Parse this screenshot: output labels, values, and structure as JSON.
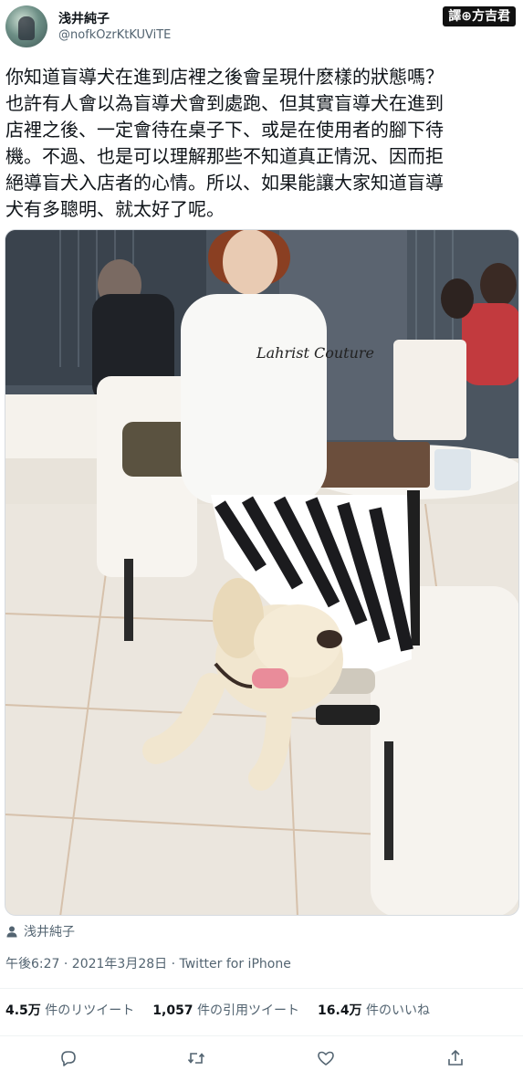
{
  "user": {
    "display_name": "浅井純子",
    "handle": "@nofkOzrKtKUViTE"
  },
  "watermark": "譯⊕方吉君",
  "tweet": {
    "text": "你知道盲導犬在進到店裡之後會呈現什麽樣的狀態嗎？\n也許有人會以為盲導犬會到處跑、但其實盲導犬在進到\n店裡之後、一定會待在桌子下、或是在使用者的腳下待\n機。不過、也是可以理解那些不知道真正情況、因而拒\n絕導盲犬入店者的心情。所以、如果能讓大家知道盲導\n犬有多聰明、就太好了呢。"
  },
  "photo": {
    "shirt_text": "Lahrist Couture"
  },
  "author_credit": {
    "icon": "person-icon",
    "name": "浅井純子"
  },
  "meta": {
    "timestamp": "午後6:27 · 2021年3月28日 · Twitter for iPhone"
  },
  "stats": {
    "retweets_value": "4.5万",
    "retweets_label": "件のリツイート",
    "quotes_value": "1,057",
    "quotes_label": "件の引用ツイート",
    "likes_value": "16.4万",
    "likes_label": "件のいいね"
  },
  "actions": {
    "icons": [
      "reply-icon",
      "retweet-icon",
      "like-icon",
      "share-icon"
    ]
  },
  "colors": {
    "text_primary": "#0f1419",
    "text_secondary": "#536471",
    "divider": "#eff3f4"
  }
}
